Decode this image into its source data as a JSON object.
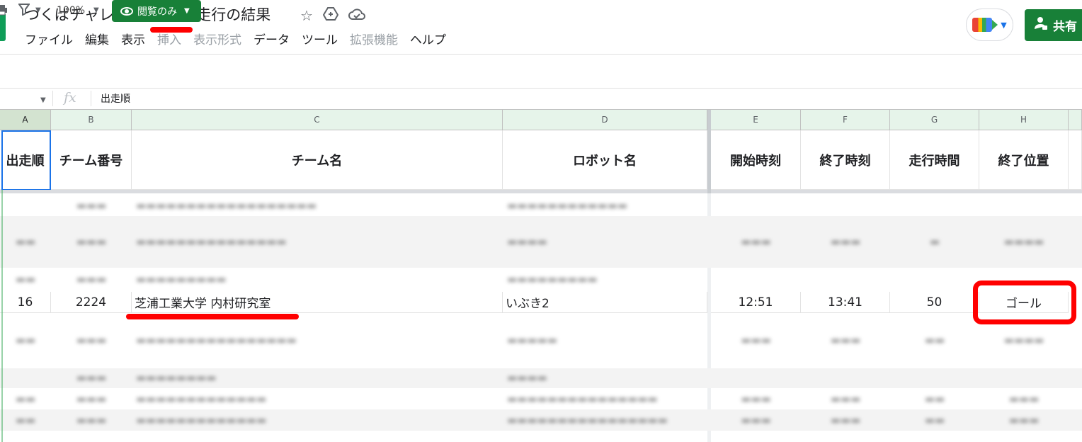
{
  "title_bar": {
    "doc_title": "つくばチャレンジ2022本走行の結果",
    "icons": [
      "star-icon",
      "move-to-drive-icon",
      "cloud-status-icon"
    ],
    "share_label": "共有"
  },
  "menu": {
    "items": [
      {
        "label": "ファイル",
        "enabled": true
      },
      {
        "label": "編集",
        "enabled": true
      },
      {
        "label": "表示",
        "enabled": true
      },
      {
        "label": "挿入",
        "enabled": false
      },
      {
        "label": "表示形式",
        "enabled": false
      },
      {
        "label": "データ",
        "enabled": true
      },
      {
        "label": "ツール",
        "enabled": true
      },
      {
        "label": "拡張機能",
        "enabled": false
      },
      {
        "label": "ヘルプ",
        "enabled": true
      }
    ]
  },
  "toolbar": {
    "zoom": "100%",
    "view_only_label": "閲覧のみ"
  },
  "formula_bar": {
    "fx_label": "fx",
    "value": "出走順"
  },
  "columns": [
    "A",
    "B",
    "C",
    "D",
    "E",
    "F",
    "G",
    "H"
  ],
  "header_row": {
    "start_order": "出走順",
    "team_no": "チーム番号",
    "team_name": "チーム名",
    "robot_name": "ロボット名",
    "start_time": "開始時刻",
    "end_time": "終了時刻",
    "run_time": "走行時間",
    "end_position": "終了位置"
  },
  "highlight_row": {
    "start_order": "16",
    "team_no": "2224",
    "team_name": "芝浦工業大学 内村研究室",
    "robot_name": "いぶき2",
    "start_time": "12:51",
    "end_time": "13:41",
    "run_time": "50",
    "end_position": "ゴール"
  },
  "colors": {
    "accent_green": "#188038",
    "annotation_red": "#ff0000",
    "selection_blue": "#1a73e8"
  }
}
